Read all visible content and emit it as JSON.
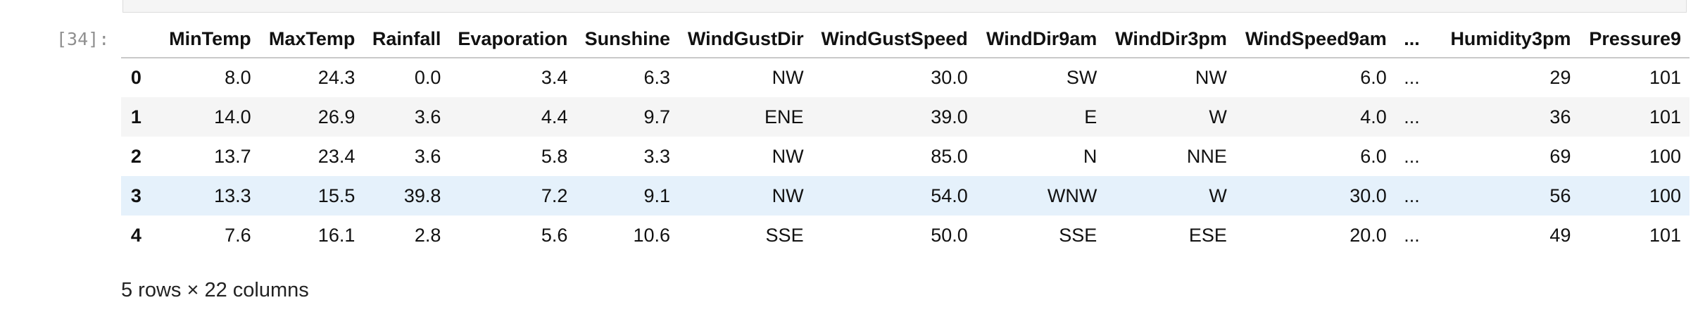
{
  "cell": {
    "prompt": "[34]:",
    "prev_code_fragment": "_"
  },
  "table": {
    "index_header": "",
    "columns": [
      "MinTemp",
      "MaxTemp",
      "Rainfall",
      "Evaporation",
      "Sunshine",
      "WindGustDir",
      "WindGustSpeed",
      "WindDir9am",
      "WindDir3pm",
      "WindSpeed9am",
      "...",
      "Humidity3pm",
      "Pressure9"
    ],
    "rows": [
      {
        "index": "0",
        "cells": [
          "8.0",
          "24.3",
          "0.0",
          "3.4",
          "6.3",
          "NW",
          "30.0",
          "SW",
          "NW",
          "6.0",
          "...",
          "29",
          "101"
        ]
      },
      {
        "index": "1",
        "cells": [
          "14.0",
          "26.9",
          "3.6",
          "4.4",
          "9.7",
          "ENE",
          "39.0",
          "E",
          "W",
          "4.0",
          "...",
          "36",
          "101"
        ]
      },
      {
        "index": "2",
        "cells": [
          "13.7",
          "23.4",
          "3.6",
          "5.8",
          "3.3",
          "NW",
          "85.0",
          "N",
          "NNE",
          "6.0",
          "...",
          "69",
          "100"
        ]
      },
      {
        "index": "3",
        "cells": [
          "13.3",
          "15.5",
          "39.8",
          "7.2",
          "9.1",
          "NW",
          "54.0",
          "WNW",
          "W",
          "30.0",
          "...",
          "56",
          "100"
        ]
      },
      {
        "index": "4",
        "cells": [
          "7.6",
          "16.1",
          "2.8",
          "5.6",
          "10.6",
          "SSE",
          "50.0",
          "SSE",
          "ESE",
          "20.0",
          "...",
          "49",
          "101"
        ]
      }
    ],
    "summary": "5 rows × 22 columns"
  },
  "colors": {
    "stripe": "#f5f5f5",
    "hover_row": "#e5f1fb",
    "prompt": "#8f8f8f"
  }
}
